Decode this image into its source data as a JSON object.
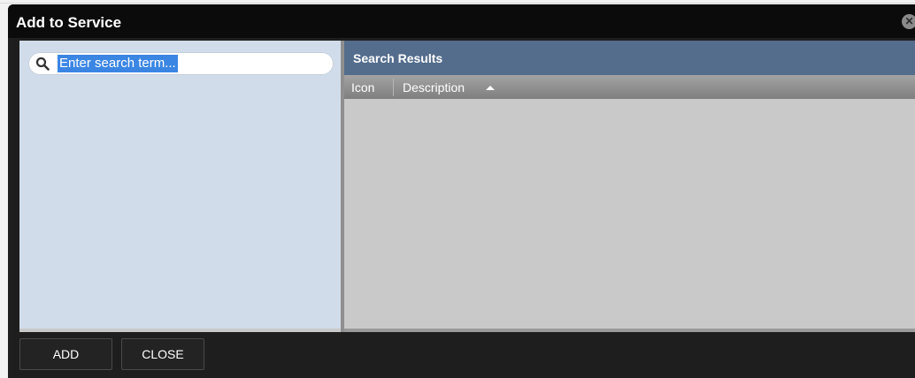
{
  "dialog": {
    "title": "Add to Service",
    "close_icon": "close-circle-icon"
  },
  "search": {
    "icon": "search-icon",
    "placeholder": "Enter search term...",
    "value": "Enter search term..."
  },
  "results": {
    "title": "Search Results",
    "columns": [
      {
        "label": "Icon"
      },
      {
        "label": "Description",
        "sort": "ascending"
      }
    ],
    "rows": []
  },
  "footer": {
    "add_label": "ADD",
    "close_label": "CLOSE"
  },
  "colors": {
    "titlebar": "#0b0b0b",
    "left_panel": "#d1dcea",
    "results_header": "#546d8d",
    "selection": "#3b86e3"
  }
}
